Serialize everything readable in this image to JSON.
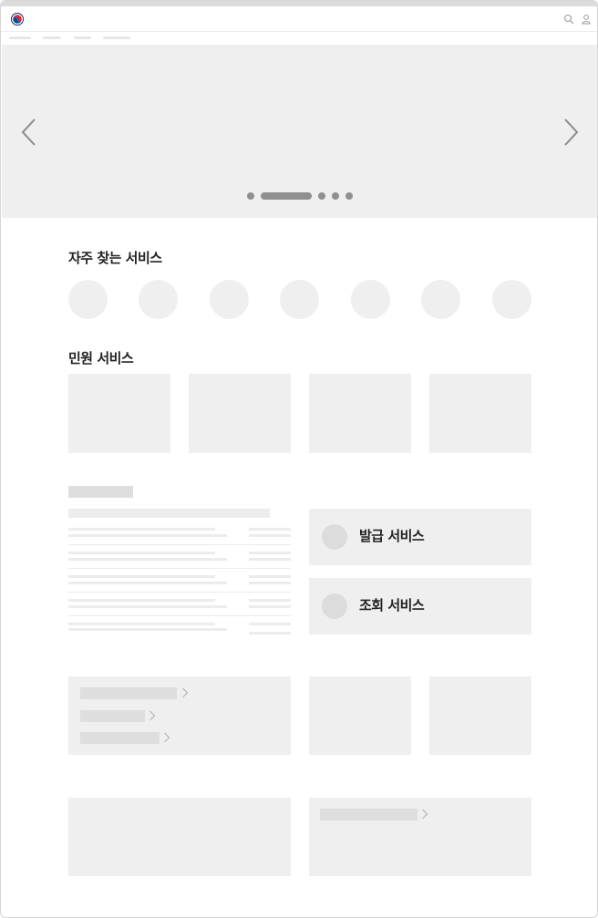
{
  "header": {
    "logo_icon": "government-taegeuk-logo-icon",
    "search_icon": "search-icon",
    "user_icon": "user-icon"
  },
  "hero": {
    "prev_icon": "chevron-left-icon",
    "next_icon": "chevron-right-icon",
    "slide_count": 5,
    "active_slide": 2
  },
  "sections": {
    "frequent_title": "자주 찾는 서비스",
    "civil_title": "민원 서비스"
  },
  "services": {
    "issue_label": "발급 서비스",
    "lookup_label": "조회 서비스"
  },
  "colors": {
    "placeholder": "#efefef",
    "placeholder_dark": "#dedede",
    "indicator": "#8f8f8f",
    "text": "#222222"
  }
}
